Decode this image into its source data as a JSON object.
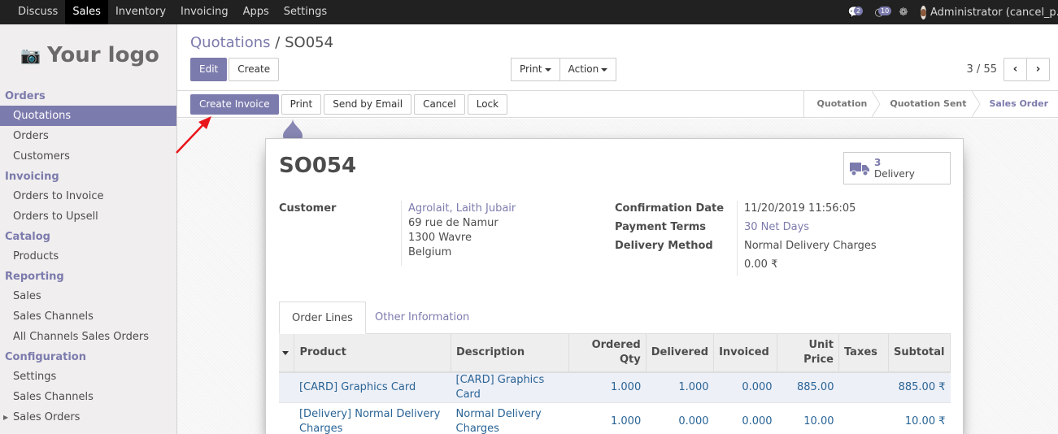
{
  "topbar": {
    "menu": [
      "Discuss",
      "Sales",
      "Inventory",
      "Invoicing",
      "Apps",
      "Settings"
    ],
    "active": "Sales",
    "messages_badge": "2",
    "activity_badge": "10",
    "user": "Administrator (cancel_p..."
  },
  "sidebar": {
    "logo_text": "Your logo",
    "sections": [
      {
        "title": "Orders",
        "items": [
          "Quotations",
          "Orders",
          "Customers"
        ]
      },
      {
        "title": "Invoicing",
        "items": [
          "Orders to Invoice",
          "Orders to Upsell"
        ]
      },
      {
        "title": "Catalog",
        "items": [
          "Products"
        ]
      },
      {
        "title": "Reporting",
        "items": [
          "Sales",
          "Sales Channels",
          "All Channels Sales Orders"
        ]
      },
      {
        "title": "Configuration",
        "items": [
          "Settings",
          "Sales Channels",
          "Sales Orders"
        ]
      }
    ],
    "active_item": "Quotations"
  },
  "breadcrumb": {
    "parent": "Quotations",
    "separator": "/",
    "current": "SO054"
  },
  "control": {
    "edit": "Edit",
    "create": "Create",
    "print": "Print",
    "action": "Action",
    "pager": "3 / 55",
    "prev": "‹",
    "next": "›"
  },
  "statusbar": {
    "buttons": [
      "Create Invoice",
      "Print",
      "Send by Email",
      "Cancel",
      "Lock"
    ],
    "stages": [
      "Quotation",
      "Quotation Sent",
      "Sales Order"
    ],
    "current_stage": "Sales Order"
  },
  "form": {
    "title": "SO054",
    "smart_button": {
      "count": "3",
      "label": "Delivery"
    },
    "customer_label": "Customer",
    "customer_name": "Agrolait, Laith Jubair",
    "customer_address": [
      "69 rue de Namur",
      "1300 Wavre",
      "Belgium"
    ],
    "confirmation_date_label": "Confirmation Date",
    "confirmation_date": "11/20/2019 11:56:05",
    "payment_terms_label": "Payment Terms",
    "payment_terms": "30 Net Days",
    "delivery_method_label": "Delivery Method",
    "delivery_method": "Normal Delivery Charges",
    "delivery_amount": "0.00 ₹",
    "tabs": [
      "Order Lines",
      "Other Information"
    ],
    "table": {
      "headers": {
        "product": "Product",
        "description": "Description",
        "ordered_qty": [
          "Ordered",
          "Qty"
        ],
        "delivered": "Delivered",
        "invoiced": "Invoiced",
        "unit_price": [
          "Unit",
          "Price"
        ],
        "taxes": "Taxes",
        "subtotal": "Subtotal"
      },
      "rows": [
        {
          "product": "[CARD] Graphics Card",
          "description": "[CARD] Graphics Card",
          "ordered_qty": "1.000",
          "delivered": "1.000",
          "invoiced": "0.000",
          "unit_price": "885.00",
          "taxes": "",
          "subtotal": "885.00 ₹"
        },
        {
          "product": "[Delivery] Normal Delivery Charges",
          "description": "Normal Delivery Charges",
          "ordered_qty": "1.000",
          "delivered": "0.000",
          "invoiced": "0.000",
          "unit_price": "10.00",
          "taxes": "",
          "subtotal": "10.00 ₹"
        }
      ]
    }
  },
  "colors": {
    "accent": "#7c7bad",
    "navbar": "#212121",
    "sidebar": "#f0eeee",
    "link_row": "#2a6496",
    "annotation_arrow": "#e8161b"
  }
}
